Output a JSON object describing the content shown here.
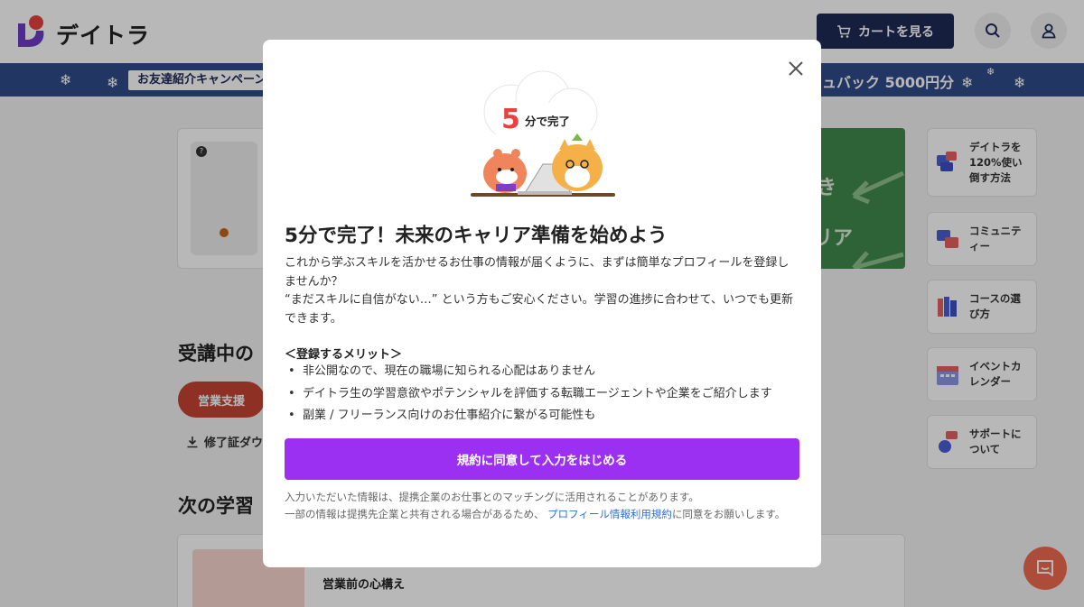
{
  "header": {
    "logo_text": "デイトラ",
    "cart_label": "カートを見る"
  },
  "banner": {
    "left_text": "お友達紹介キャンペーン",
    "right_text": "ュバック 5000円分"
  },
  "main": {
    "section_courses": "受講中の",
    "course_tag": "営業支援",
    "download_link": "修了証ダウ",
    "section_next": "次の学習",
    "next_lesson": "営業前の心構え",
    "help_badge": "?",
    "green_card_line1": "き",
    "green_card_line2": "リア"
  },
  "sidebar": {
    "items": [
      {
        "label": "デイトラを120%使い倒す方法"
      },
      {
        "label": "コミュニティー"
      },
      {
        "label": "コースの選び方"
      },
      {
        "label": "イベントカレンダー"
      },
      {
        "label": "サポートについて"
      }
    ]
  },
  "modal": {
    "badge_number": "5",
    "badge_text": "分で完了",
    "title": "5分で完了！未来のキャリア準備を始めよう",
    "para1": "これから学ぶスキルを活かせるお仕事の情報が届くように、まずは簡単なプロフィールを登録しませんか？",
    "para2": "“まだスキルに自信がない…” という方もご安心ください。学習の進捗に合わせて、いつでも更新できます。",
    "merit_heading": "＜登録するメリット＞",
    "merits": [
      "非公開なので、現在の職場に知られる心配はありません",
      "デイトラ生の学習意欲やポテンシャルを評価する転職エージェントや企業をご紹介します",
      "副業 / フリーランス向けのお仕事紹介に繋がる可能性も"
    ],
    "cta_label": "規約に同意して入力をはじめる",
    "footnote_line1": "入力いただいた情報は、提携企業のお仕事とのマッチングに活用されることがあります。",
    "footnote_line2_pre": "一部の情報は提携先企業と共有される場合があるため、",
    "footnote_link": "プロフィール情報利用規約",
    "footnote_line2_post": "に同意をお願いします。"
  },
  "colors": {
    "cta": "#9b30f3",
    "cart": "#1f2a56",
    "banner": "#2e4c88",
    "tag": "#c54532",
    "chat_fab": "#f06a4f",
    "link": "#2b6fd8"
  }
}
